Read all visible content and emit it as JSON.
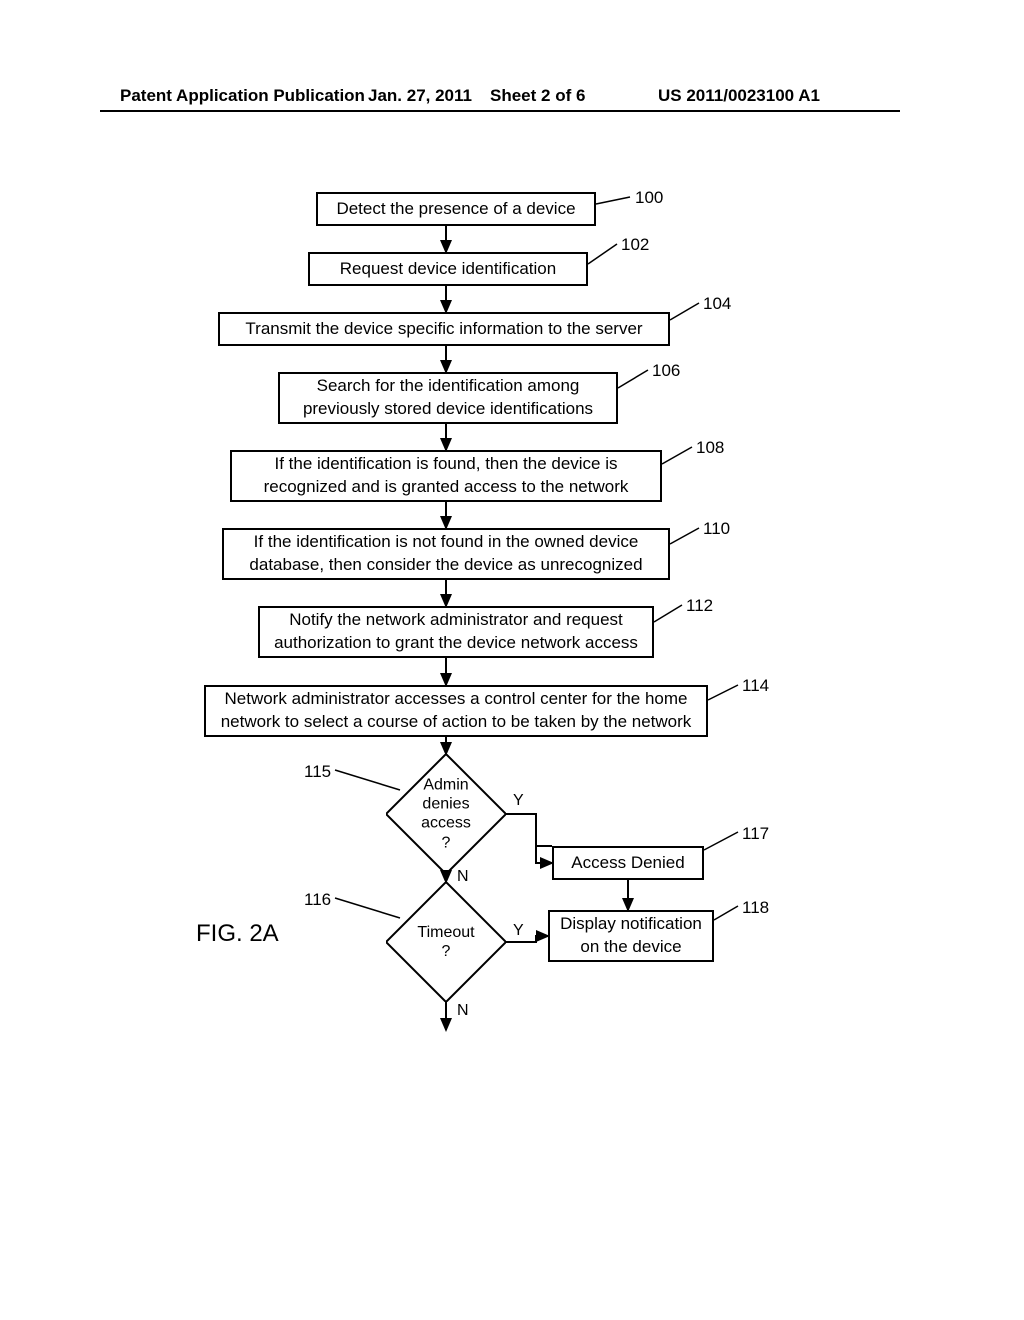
{
  "header": {
    "left": "Patent Application Publication",
    "date": "Jan. 27, 2011",
    "sheet": "Sheet 2 of 6",
    "pubno": "US 2011/0023100 A1"
  },
  "fig_caption": "FIG. 2A",
  "steps": {
    "s100": "Detect the presence of a device",
    "s102": "Request device identification",
    "s104": "Transmit the device specific information to the server",
    "s106": "Search for the identification among previously stored device identifications",
    "s108": "If the identification is found, then the device is recognized and is granted access to the network",
    "s110": "If the identification is not found in the owned device database, then consider the device as unrecognized",
    "s112": "Notify the network administrator and request authorization to grant the device network access",
    "s114": "Network administrator accesses a control center for the home network to select a course of action to be taken by the network",
    "d115": "Admin denies access ?",
    "d116": "Timeout ?",
    "s117": "Access Denied",
    "s118": "Display notification on the device"
  },
  "refs": {
    "r100": "100",
    "r102": "102",
    "r104": "104",
    "r106": "106",
    "r108": "108",
    "r110": "110",
    "r112": "112",
    "r114": "114",
    "r115": "115",
    "r116": "116",
    "r117": "117",
    "r118": "118"
  },
  "branches": {
    "yes": "Y",
    "no": "N"
  }
}
